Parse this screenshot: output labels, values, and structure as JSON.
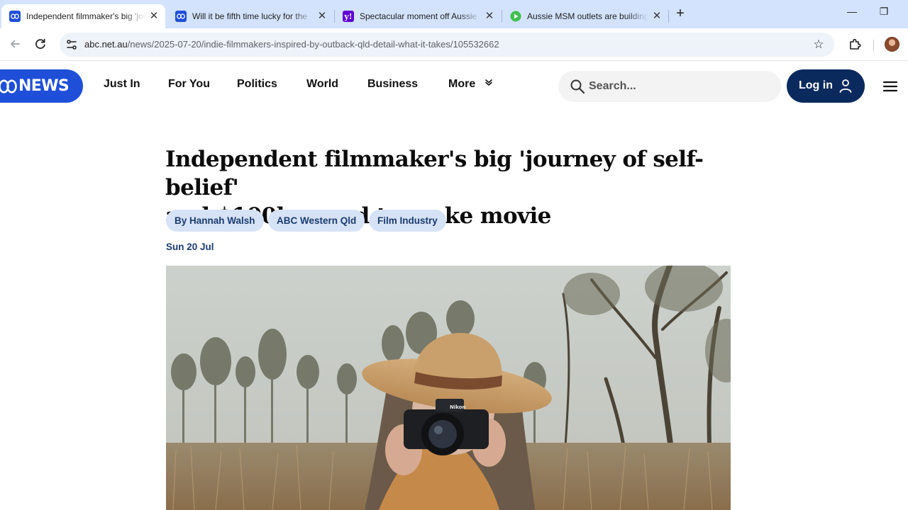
{
  "browser": {
    "tabs": [
      {
        "title": "Independent filmmaker's big 'journey of self-belief'",
        "favicon": "abc-news-icon",
        "active": true
      },
      {
        "title": "Will it be fifth time lucky for the",
        "favicon": "abc-news-icon",
        "active": false
      },
      {
        "title": "Spectacular moment off Aussie",
        "favicon": "yahoo-icon",
        "active": false
      },
      {
        "title": "Aussie MSM outlets are building",
        "favicon": "play-icon",
        "active": false
      }
    ],
    "new_tab": "+",
    "window_controls": {
      "minimize": "—",
      "restore": "❐"
    },
    "url_host": "abc.net.au",
    "url_path": "/news/2025-07-20/indie-filmmakers-inspired-by-outback-qld-detail-what-it-takes/105532662"
  },
  "site": {
    "logo_text": "NEWS",
    "nav": [
      {
        "label": "Just In"
      },
      {
        "label": "For You"
      },
      {
        "label": "Politics"
      },
      {
        "label": "World"
      },
      {
        "label": "Business"
      },
      {
        "label": "More"
      }
    ],
    "search_placeholder": "Search...",
    "login_label": "Log in"
  },
  "article": {
    "headline_line1": "Independent filmmaker's big 'journey of self-belief'",
    "headline_line2": "and $100k spend to make movie",
    "tags": [
      {
        "label": "By Hannah Walsh"
      },
      {
        "label": "ABC Western Qld"
      },
      {
        "label": "Film Industry"
      }
    ],
    "date": "Sun 20 Jul",
    "hero_camera_brand": "Nikon"
  },
  "colors": {
    "tabstrip": "#d3e3fd",
    "abc_blue": "#1f4fd8",
    "login_navy": "#0a2a5e",
    "tag_bg": "#d6e2f6",
    "tag_text": "#1b3b6f"
  }
}
